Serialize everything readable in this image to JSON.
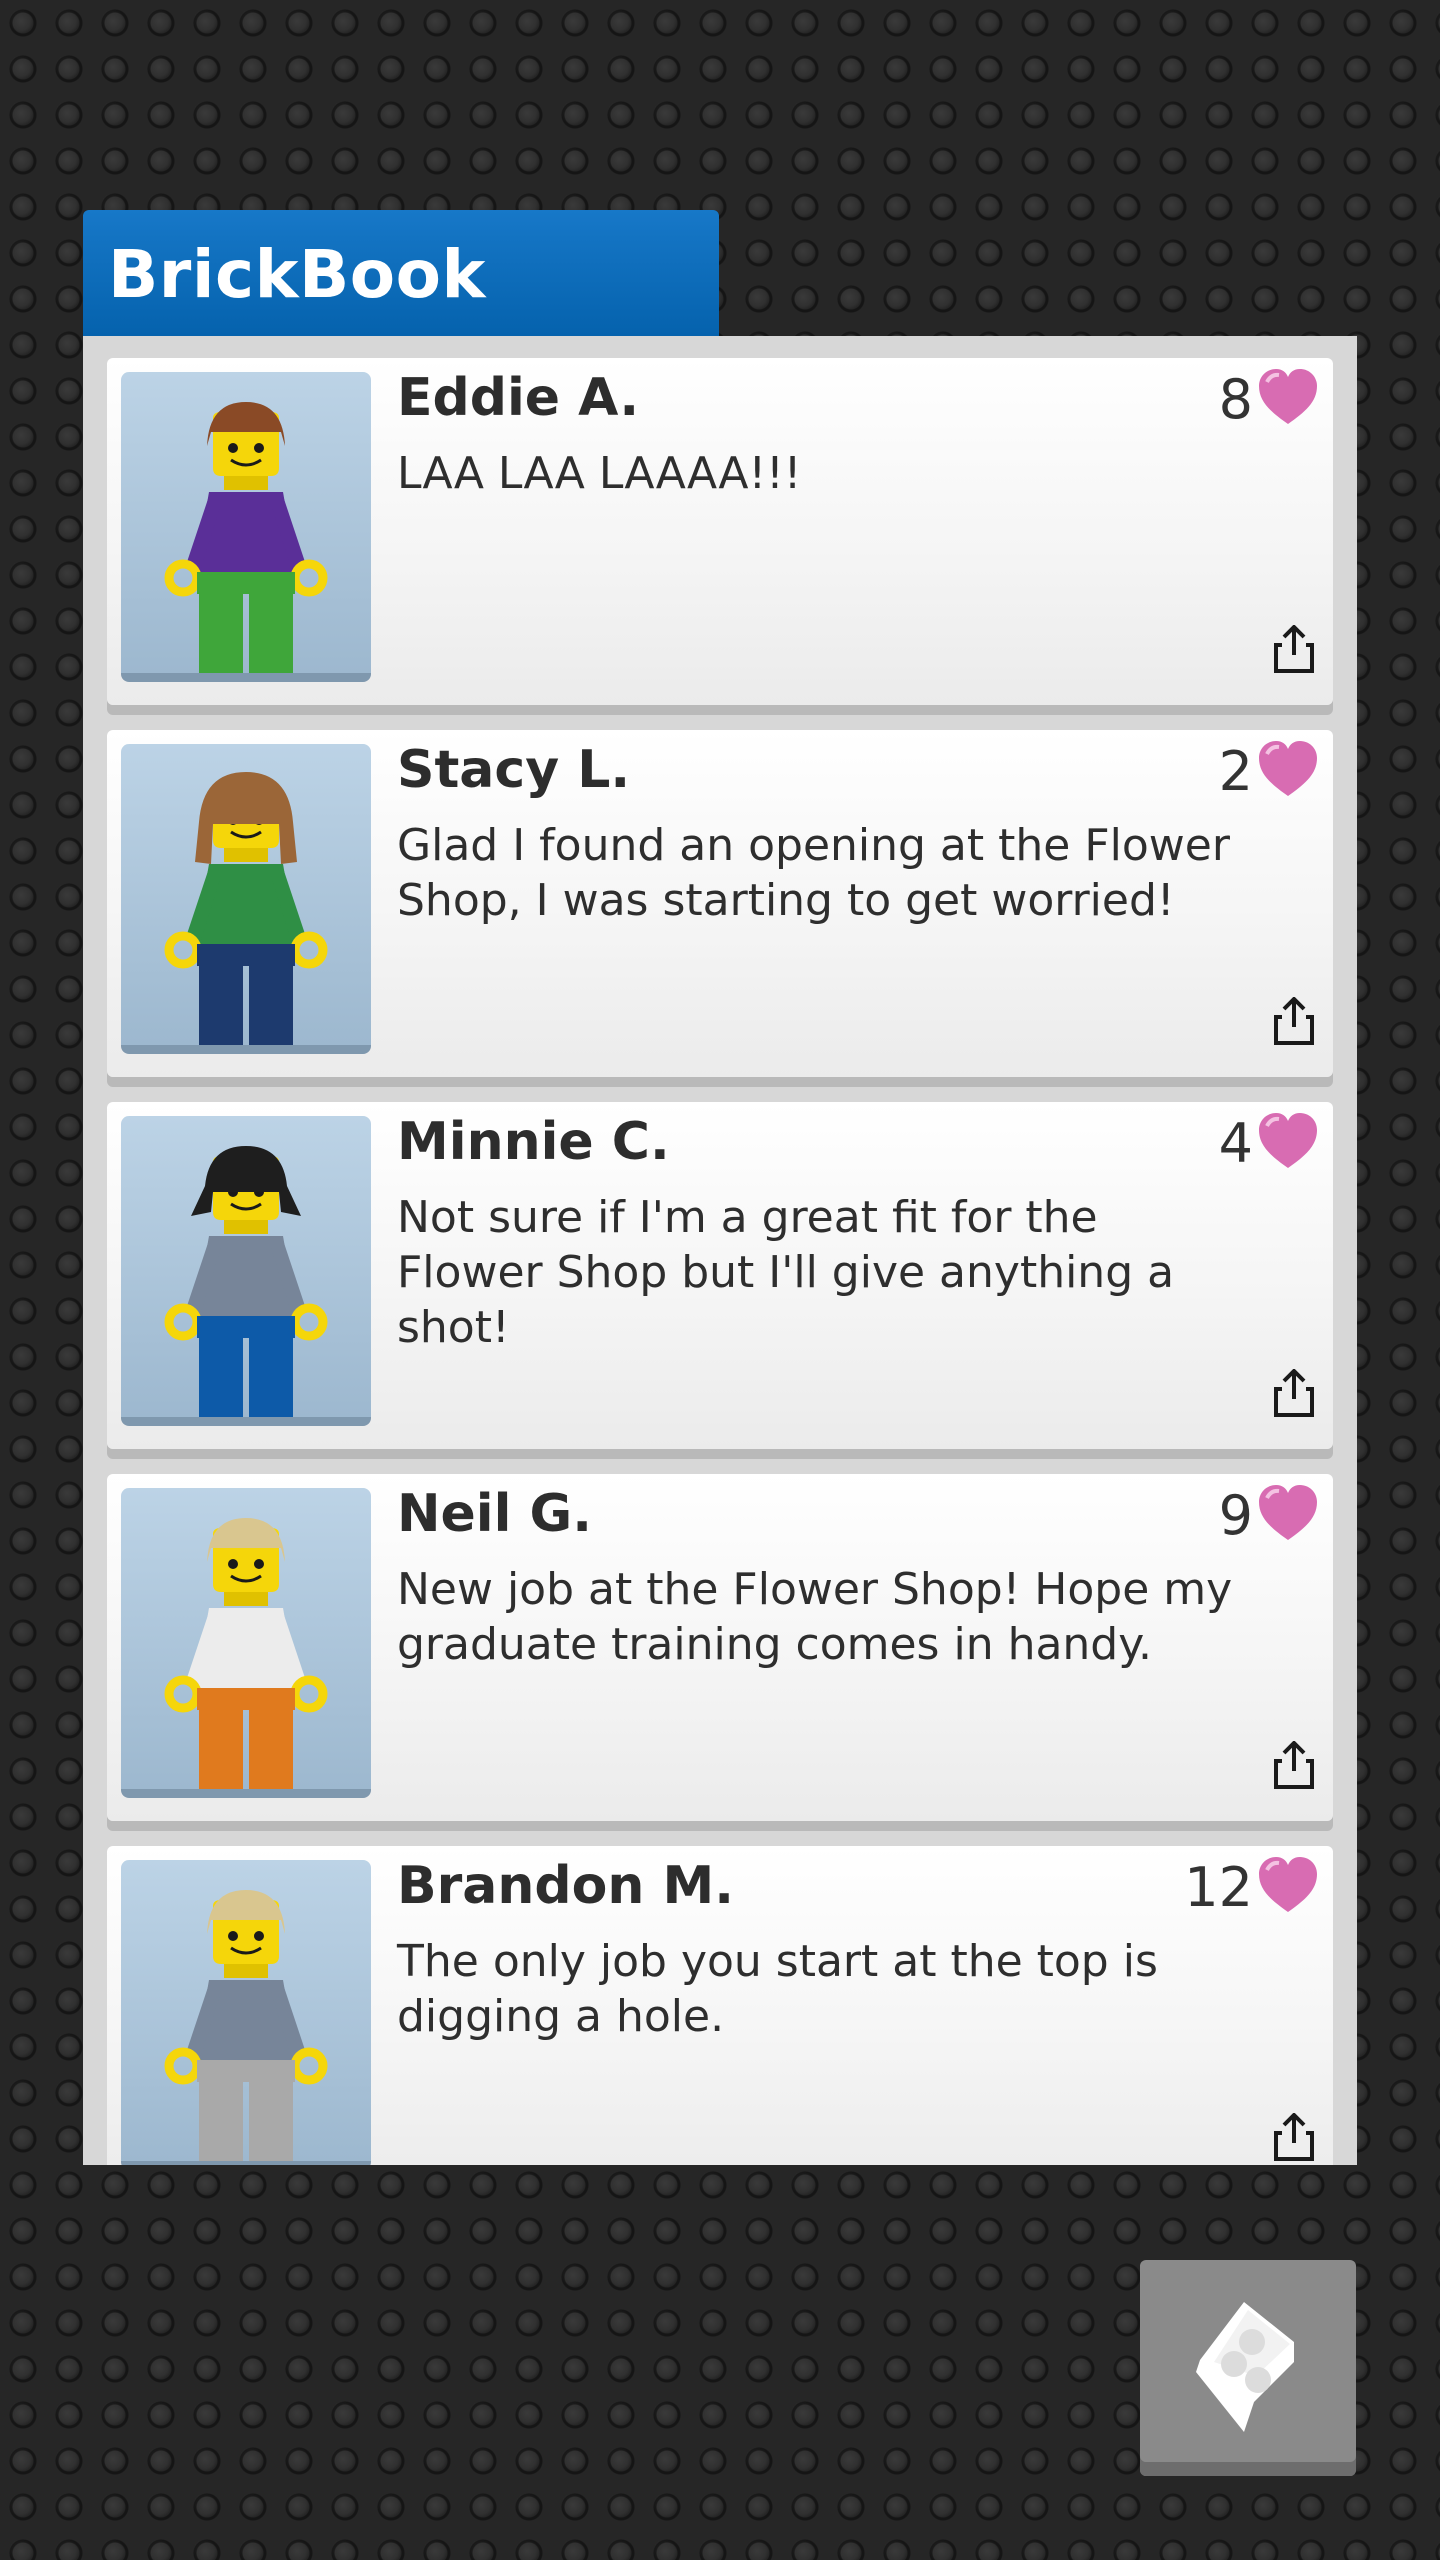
{
  "app": {
    "title": "BrickBook"
  },
  "posts": [
    {
      "name": "Eddie A.",
      "message": "LAA LAA LAAAA!!!",
      "likes": "8",
      "avatar": {
        "hair": "#8a4a26",
        "torso": "#5a2f98",
        "legs": "#3fa63a",
        "hair_style": "short"
      }
    },
    {
      "name": "Stacy L.",
      "message": "Glad I found an opening at the Flower Shop, I was starting to get worried!",
      "likes": "2",
      "avatar": {
        "hair": "#9b6638",
        "torso": "#2f8f45",
        "legs": "#1d3a6e",
        "hair_style": "long"
      }
    },
    {
      "name": "Minnie C.",
      "message": "Not sure if I'm a great fit for the Flower Shop but I'll give anything a shot!",
      "likes": "4",
      "avatar": {
        "hair": "#1e1e1e",
        "torso": "#778599",
        "legs": "#0d5aa8",
        "hair_style": "pigtails"
      }
    },
    {
      "name": "Neil G.",
      "message": "New job at the Flower Shop! Hope my graduate training comes in handy.",
      "likes": "9",
      "avatar": {
        "hair": "#d9c68f",
        "torso": "#ececec",
        "legs": "#e07a1e",
        "hair_style": "short"
      }
    },
    {
      "name": "Brandon M.",
      "message": "The only job you start at the top is digging a hole.",
      "likes": "12",
      "avatar": {
        "hair": "#d9c68f",
        "torso": "#778599",
        "legs": "#a9a9a9",
        "hair_style": "short"
      }
    }
  ],
  "icons": {
    "like": "heart-icon",
    "share": "share-icon",
    "back": "back-brick-icon"
  },
  "colors": {
    "header": "#0562ad",
    "heart": "#d86cb2",
    "background": "#262626"
  }
}
